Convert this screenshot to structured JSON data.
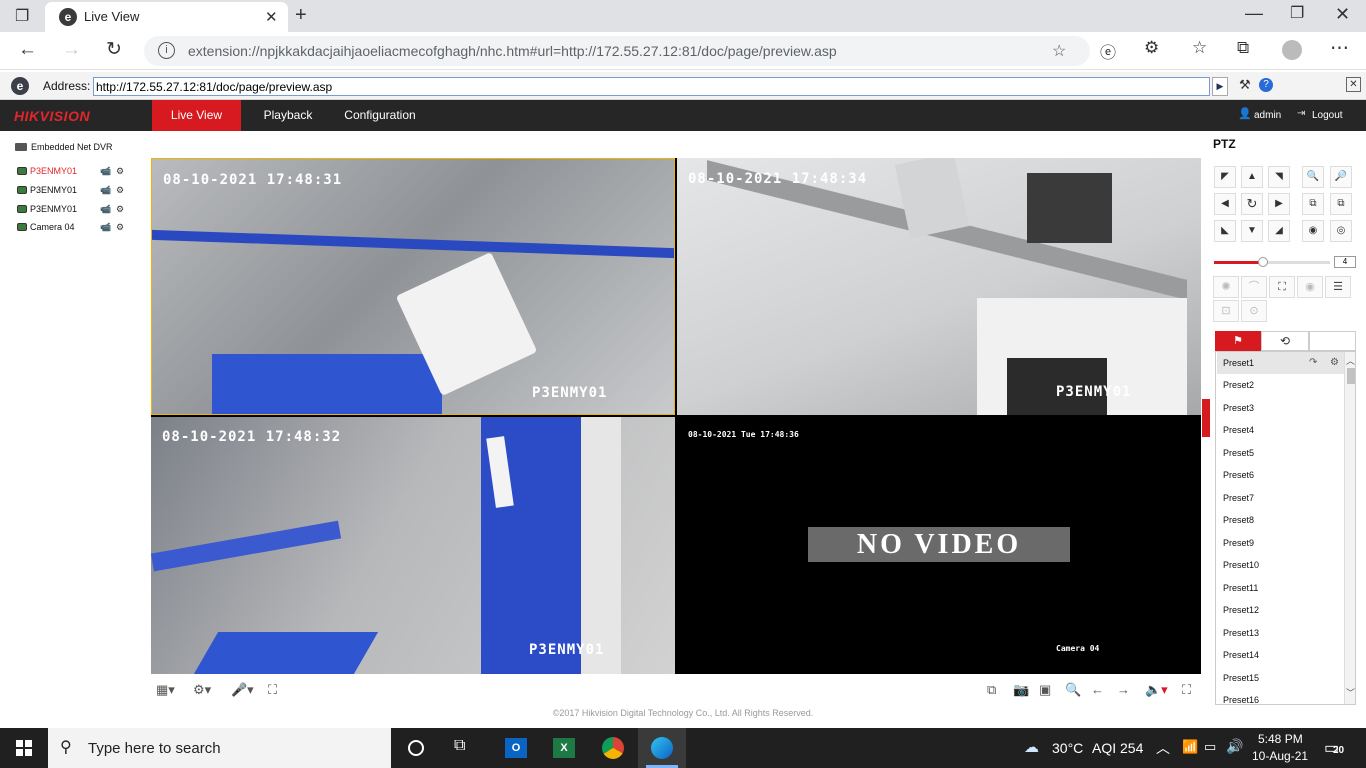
{
  "browser": {
    "tab_title": "Live View",
    "tab_icon": "ie-icon",
    "url": "extension://npjkkakdacjaihjaoeliacmecofghagh/nhc.htm#url=http://172.55.27.12:81/doc/page/preview.asp",
    "ie_address_label": "Address:",
    "ie_address": "http://172.55.27.12:81/doc/page/preview.asp"
  },
  "app": {
    "logo": "HIKVISION",
    "nav": [
      "Live View",
      "Playback",
      "Configuration"
    ],
    "active_nav": "Live View",
    "user": "admin",
    "logout": "Logout",
    "brand_color": "#d71920"
  },
  "device_tree": {
    "root": "Embedded Net DVR",
    "cameras": [
      {
        "name": "P3ENMY01",
        "active": true
      },
      {
        "name": "P3ENMY01",
        "active": false
      },
      {
        "name": "P3ENMY01",
        "active": false
      },
      {
        "name": "Camera 04",
        "active": false
      }
    ]
  },
  "views": [
    {
      "timestamp": "08-10-2021 17:48:31",
      "label": "P3ENMY01",
      "selected": true
    },
    {
      "timestamp": "08-10-2021 17:48:34",
      "label": "P3ENMY01",
      "selected": false
    },
    {
      "timestamp": "08-10-2021 17:48:32",
      "label": "P3ENMY01",
      "selected": false
    },
    {
      "timestamp": "08-10-2021 Tue 17:48:36",
      "label": "Camera 04",
      "no_video": "NO VIDEO",
      "selected": false
    }
  ],
  "footer": "©2017 Hikvision Digital Technology Co., Ltd. All Rights Reserved.",
  "ptz": {
    "title": "PTZ",
    "speed": "4",
    "speed_fraction": 0.42,
    "presets": [
      "Preset1",
      "Preset2",
      "Preset3",
      "Preset4",
      "Preset5",
      "Preset6",
      "Preset7",
      "Preset8",
      "Preset9",
      "Preset10",
      "Preset11",
      "Preset12",
      "Preset13",
      "Preset14",
      "Preset15",
      "Preset16"
    ]
  },
  "taskbar": {
    "search_placeholder": "Type here to search",
    "weather": "30°C",
    "aqi": "AQI 254",
    "time": "5:48 PM",
    "date": "10-Aug-21",
    "notifications": "20"
  }
}
